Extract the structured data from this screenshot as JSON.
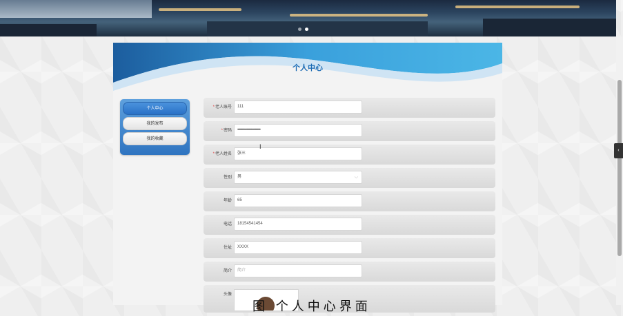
{
  "card": {
    "title": "个人中心"
  },
  "sidebar": {
    "items": [
      {
        "label": "个人中心",
        "active": true
      },
      {
        "label": "我的发布",
        "active": false
      },
      {
        "label": "我的收藏",
        "active": false
      }
    ]
  },
  "form": {
    "account": {
      "label": "老人账号",
      "required": true,
      "value": "111"
    },
    "password": {
      "label": "密码",
      "required": true,
      "value": "••••••••••••••••••••••••••••••"
    },
    "name": {
      "label": "老人姓名",
      "required": true,
      "value": "张三"
    },
    "gender": {
      "label": "性别",
      "value": "男",
      "icon": "chevron-down-icon"
    },
    "age": {
      "label": "年龄",
      "value": "65"
    },
    "phone": {
      "label": "电话",
      "value": "18154541454"
    },
    "address": {
      "label": "住址",
      "value": "XXXX"
    },
    "intro": {
      "label": "简介",
      "placeholder": "简介"
    },
    "avatar": {
      "label": "头像"
    }
  },
  "required_mark": "*",
  "collapse_icon": "‹",
  "caption": "图 个人中心界面",
  "colors": {
    "accent": "#2f74c0",
    "title": "#1e6db5",
    "required": "#e04040"
  }
}
